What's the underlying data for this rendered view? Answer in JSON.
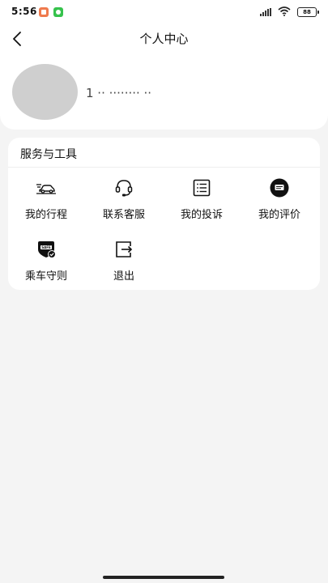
{
  "status_bar": {
    "time": "5:56",
    "battery": "88"
  },
  "header": {
    "title": "个人中心",
    "user_name": "1 ·· ········ ··"
  },
  "services": {
    "title": "服务与工具",
    "items": [
      {
        "label": "我的行程",
        "icon": "car-trip-icon"
      },
      {
        "label": "联系客服",
        "icon": "headset-icon"
      },
      {
        "label": "我的投诉",
        "icon": "list-document-icon"
      },
      {
        "label": "我的评价",
        "icon": "rating-icon"
      },
      {
        "label": "乘车守则",
        "icon": "safe-shield-icon"
      },
      {
        "label": "退出",
        "icon": "logout-icon"
      }
    ]
  }
}
